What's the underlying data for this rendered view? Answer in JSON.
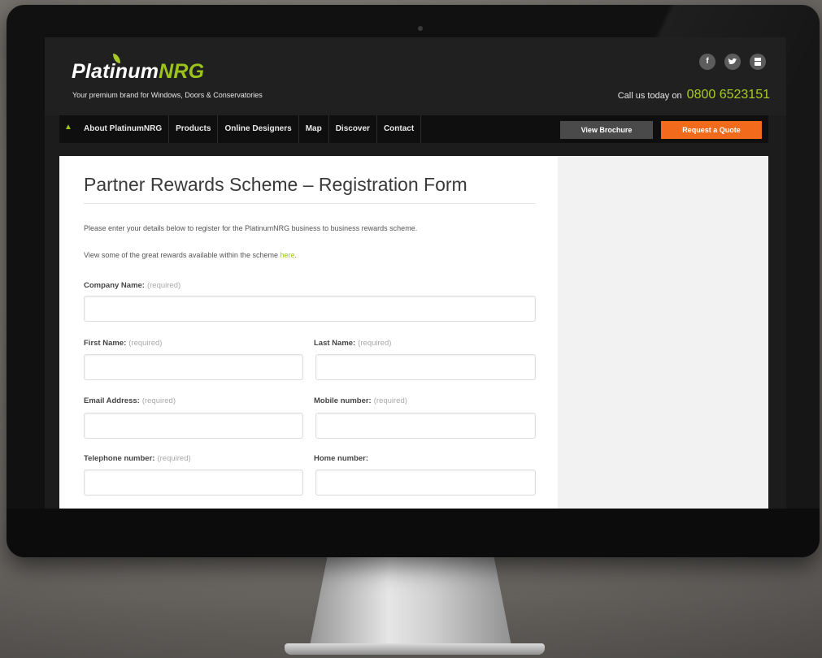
{
  "site": {
    "logo_main": "Platinum",
    "logo_accent": "NRG",
    "tagline": "Your premium brand for Windows, Doors & Conservatories",
    "call_label": "Call us today on",
    "phone": "0800 6523151",
    "social": [
      "f",
      "t",
      "yt"
    ]
  },
  "nav": {
    "items": [
      "About PlatinumNRG",
      "Products",
      "Online Designers",
      "Map",
      "Discover",
      "Contact"
    ],
    "brochure_label": "View Brochure",
    "quote_label": "Request a Quote"
  },
  "page": {
    "title": "Partner Rewards Scheme – Registration Form",
    "intro": "Please enter your details below to register for the PlatinumNRG business to business rewards scheme.",
    "rewards_text": "View some of the great rewards available within the scheme",
    "rewards_link": "here",
    "rewards_end": "."
  },
  "form": {
    "required_text": "(required)",
    "company_name": {
      "label": "Company Name:",
      "value": ""
    },
    "first_name": {
      "label": "First Name:",
      "value": ""
    },
    "last_name": {
      "label": "Last Name:",
      "value": ""
    },
    "email": {
      "label": "Email Address:",
      "value": ""
    },
    "mobile": {
      "label": "Mobile number:",
      "value": ""
    },
    "telephone": {
      "label": "Telephone number:",
      "value": ""
    },
    "home": {
      "label": "Home number:",
      "value": ""
    }
  },
  "colors": {
    "brand_green": "#9cc31a",
    "quote_orange": "#f26b1d",
    "header_dark": "#202020"
  }
}
